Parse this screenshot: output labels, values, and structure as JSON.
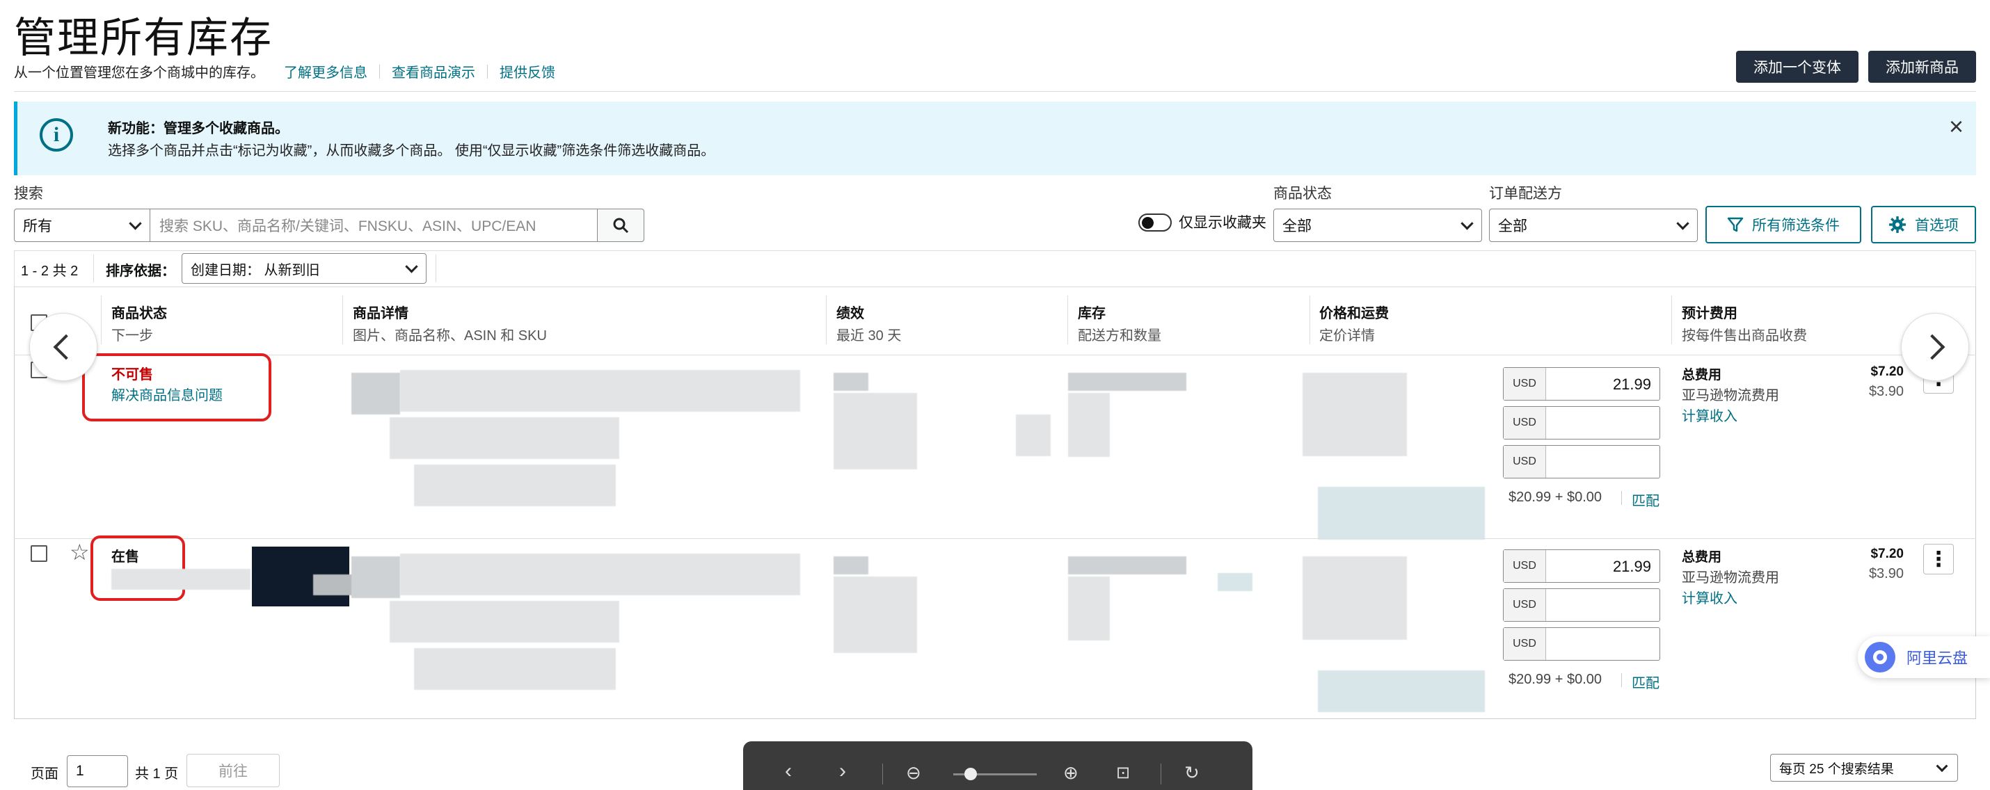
{
  "header": {
    "title": "管理所有库存",
    "subtitle": "从一个位置管理您在多个商城中的库存。",
    "links": [
      "了解更多信息",
      "查看商品演示",
      "提供反馈"
    ],
    "add_variant": "添加一个变体",
    "add_product": "添加新商品"
  },
  "banner": {
    "title": "新功能：管理多个收藏商品。",
    "text": "选择多个商品并点击“标记为收藏”，从而收藏多个商品。 使用“仅显示收藏”筛选条件筛选收藏商品。",
    "close": "×"
  },
  "filters": {
    "search_label": "搜索",
    "search_scope": "所有",
    "search_placeholder": "搜索 SKU、商品名称/关键词、FNSKU、ASIN、UPC/EAN",
    "favorites_toggle": "仅显示收藏夹",
    "status_label": "商品状态",
    "status_value": "全部",
    "fulfillment_label": "订单配送方",
    "fulfillment_value": "全部",
    "all_filters": "所有筛选条件",
    "preferences": "首选项"
  },
  "toolbar": {
    "count": "1 - 2 共 2",
    "sort_label": "排序依据：",
    "sort_value": "创建日期： 从新到旧"
  },
  "columns": [
    {
      "title": "商品状态",
      "sub": "下一步"
    },
    {
      "title": "商品详情",
      "sub": "图片、商品名称、ASIN 和 SKU"
    },
    {
      "title": "绩效",
      "sub": "最近 30 天"
    },
    {
      "title": "库存",
      "sub": "配送方和数量"
    },
    {
      "title": "价格和运费",
      "sub": "定价详情"
    },
    {
      "title": "预计费用",
      "sub": "按每件售出商品收费"
    }
  ],
  "rows": [
    {
      "status": "不可售",
      "action": "解决商品信息问题",
      "currency": "USD",
      "price": "21.99",
      "price_summary": "$20.99 + $0.00",
      "match": "匹配",
      "fee_title": "总费用",
      "fee_total": "$7.20",
      "fee_item": "亚马逊物流费用",
      "fee_item_amt": "$3.90",
      "calc": "计算收入"
    },
    {
      "status": "在售",
      "action": "",
      "currency": "USD",
      "price": "21.99",
      "price_summary": "$20.99 + $0.00",
      "match": "匹配",
      "fee_title": "总费用",
      "fee_total": "$7.20",
      "fee_item": "亚马逊物流费用",
      "fee_item_amt": "$3.90",
      "calc": "计算收入"
    }
  ],
  "pager": {
    "page_label": "页面",
    "page_value": "1",
    "total": "共 1 页",
    "go": "前往",
    "per_page": "每页 25 个搜索结果"
  },
  "aliyun": "阿里云盘",
  "colors": {
    "accent": "#007185",
    "dark_button": "#232f3e",
    "banner_bg": "#e6f6fd",
    "banner_border": "#00a8e1",
    "unsellable": "#c40000",
    "highlight": "#e02020"
  }
}
